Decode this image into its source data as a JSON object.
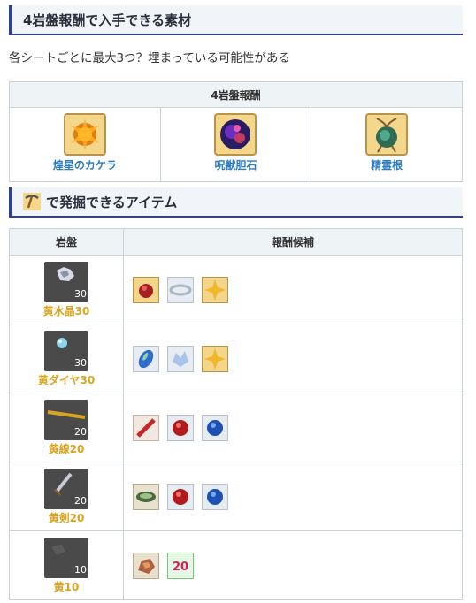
{
  "section1": {
    "title": "4岩盤報酬で入手できる素材",
    "description": "各シートごとに最大3つ？埋まっている可能性がある"
  },
  "materials_table": {
    "header": "4岩盤報酬",
    "items": [
      {
        "name": "煌星のカケラ",
        "icon": "star-fragment-icon"
      },
      {
        "name": "呪獣胆石",
        "icon": "cursed-beast-stone-icon"
      },
      {
        "name": "精霊根",
        "icon": "spirit-root-icon"
      }
    ]
  },
  "section2": {
    "title": "で発掘できるアイテム",
    "icon": "pickaxe-icon"
  },
  "dig_table": {
    "headers": [
      "岩盤",
      "報酬候補"
    ],
    "rows": [
      {
        "name": "黄水晶30",
        "badge": "30",
        "rewards": [
          "red-orb-icon",
          "silver-ring-icon",
          "gold-sparkle-icon"
        ]
      },
      {
        "name": "黄ダイヤ30",
        "badge": "30",
        "rewards": [
          "blue-gem-icon",
          "ice-crystal-icon",
          "gold-sparkle-icon"
        ]
      },
      {
        "name": "黄線20",
        "badge": "20",
        "rewards": [
          "red-feather-icon",
          "red-orb-icon",
          "blue-orb-icon"
        ]
      },
      {
        "name": "黄剣20",
        "badge": "20",
        "rewards": [
          "green-disc-icon",
          "red-orb-icon",
          "blue-orb-icon"
        ]
      },
      {
        "name": "黄10",
        "badge": "10",
        "rewards": [
          "bronze-ore-icon",
          "number-20-badge-icon"
        ]
      }
    ],
    "reward_badge_text": "20"
  }
}
